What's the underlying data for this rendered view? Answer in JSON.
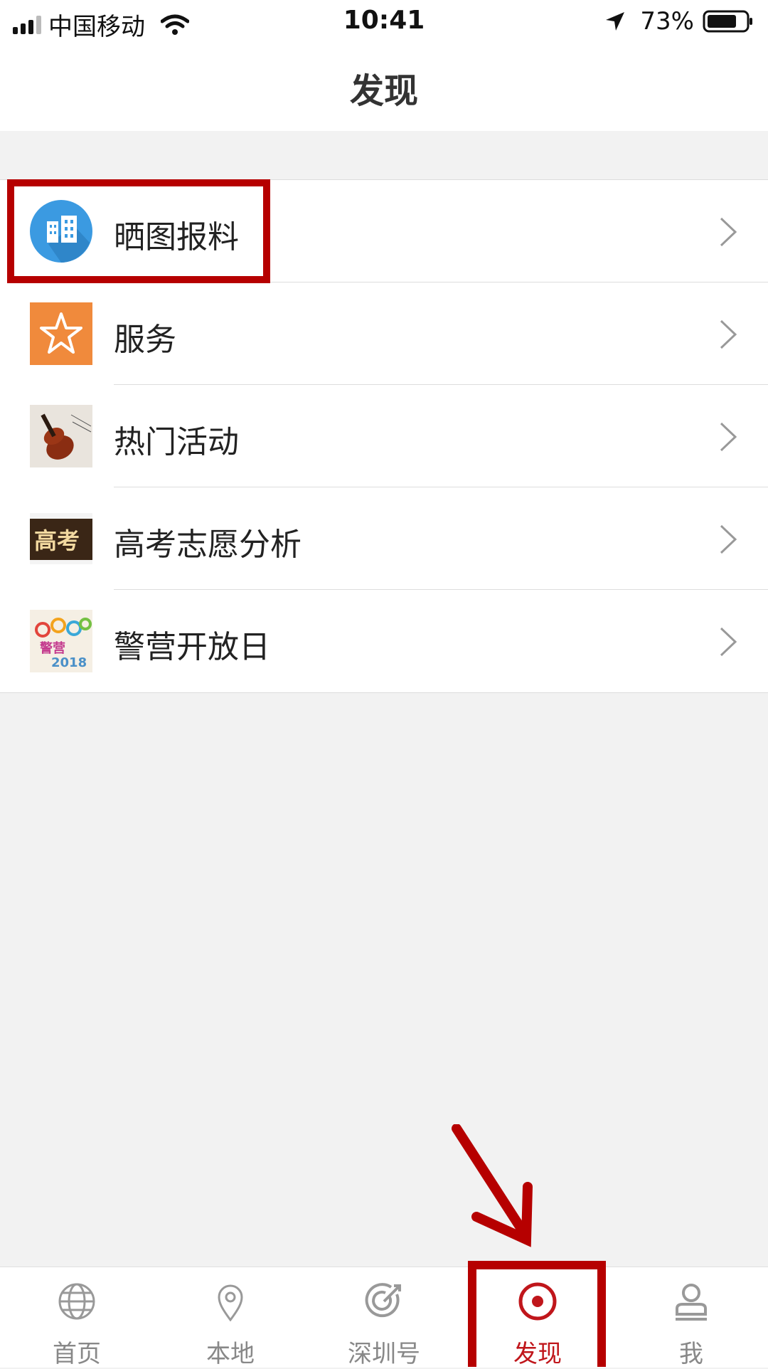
{
  "status_bar": {
    "carrier": "中国移动",
    "time": "10:41",
    "battery_percent": "73%",
    "signal_icon": "cellular-signal-icon",
    "wifi_icon": "wifi-icon",
    "location_icon": "location-arrow-icon",
    "battery_icon": "battery-icon"
  },
  "nav": {
    "title": "发现"
  },
  "list": {
    "items": [
      {
        "label": "晒图报料",
        "icon": "building-icon",
        "highlighted": true
      },
      {
        "label": "服务",
        "icon": "star-icon"
      },
      {
        "label": "热门活动",
        "icon": "violin-thumbnail"
      },
      {
        "label": "高考志愿分析",
        "icon": "gaokao-thumbnail"
      },
      {
        "label": "警营开放日",
        "icon": "police-open-day-thumbnail"
      }
    ],
    "thumb_texts": {
      "gaokao": "高考",
      "police_open_day": "警营 2018"
    }
  },
  "tabbar": {
    "tabs": [
      {
        "label": "首页",
        "icon": "globe-icon"
      },
      {
        "label": "本地",
        "icon": "map-pin-icon"
      },
      {
        "label": "深圳号",
        "icon": "target-icon"
      },
      {
        "label": "发现",
        "icon": "discover-icon",
        "active": true
      },
      {
        "label": "我",
        "icon": "user-icon"
      }
    ]
  },
  "colors": {
    "accent_red": "#c0161b",
    "annotation_red": "#b60000",
    "background": "#f2f2f2",
    "blue_icon": "#3b9ae1",
    "orange_icon": "#f08a3c"
  }
}
